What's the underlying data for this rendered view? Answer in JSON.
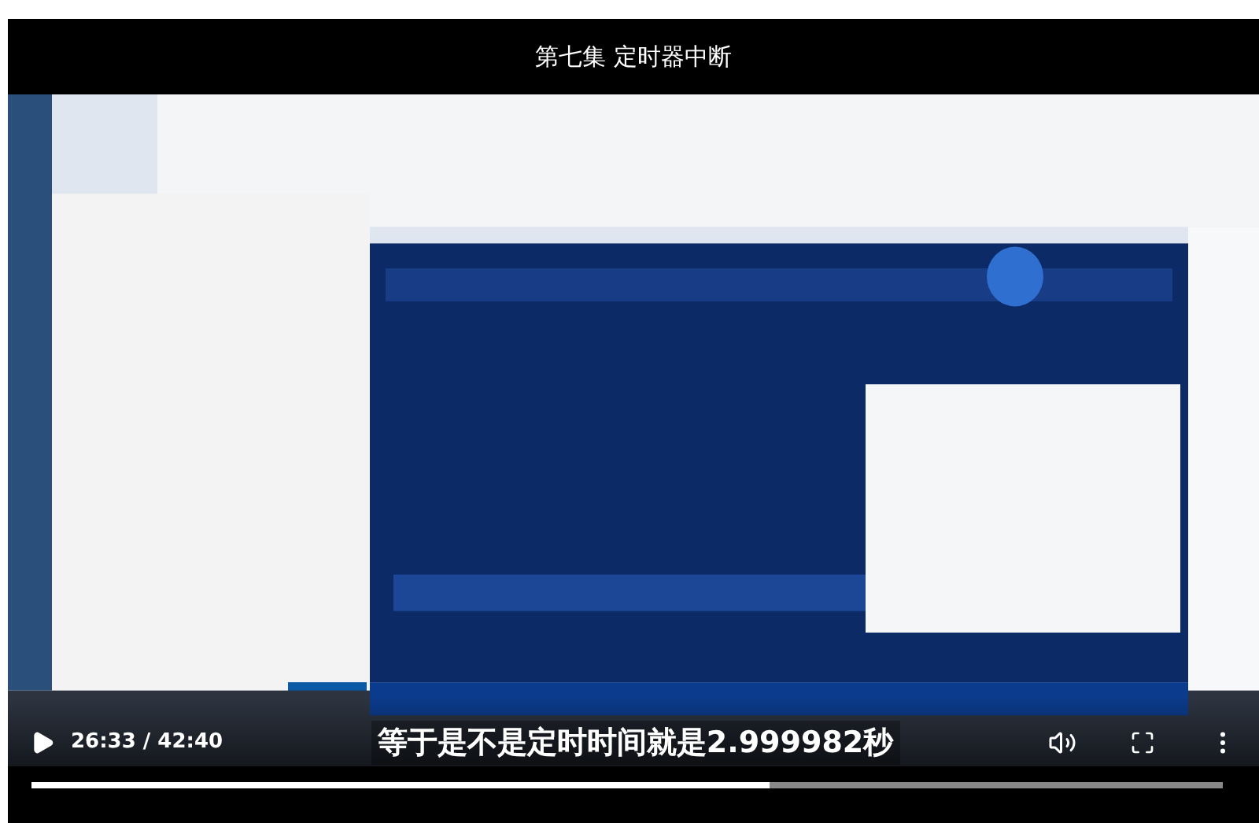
{
  "video": {
    "title": "第七集 定时器中断",
    "kind": "picture",
    "subtitle": "等于是不是定时时间就是2.999982秒"
  },
  "player": {
    "time": "26:33 / 42:40",
    "progress": {
      "level": 0.62
    }
  }
}
